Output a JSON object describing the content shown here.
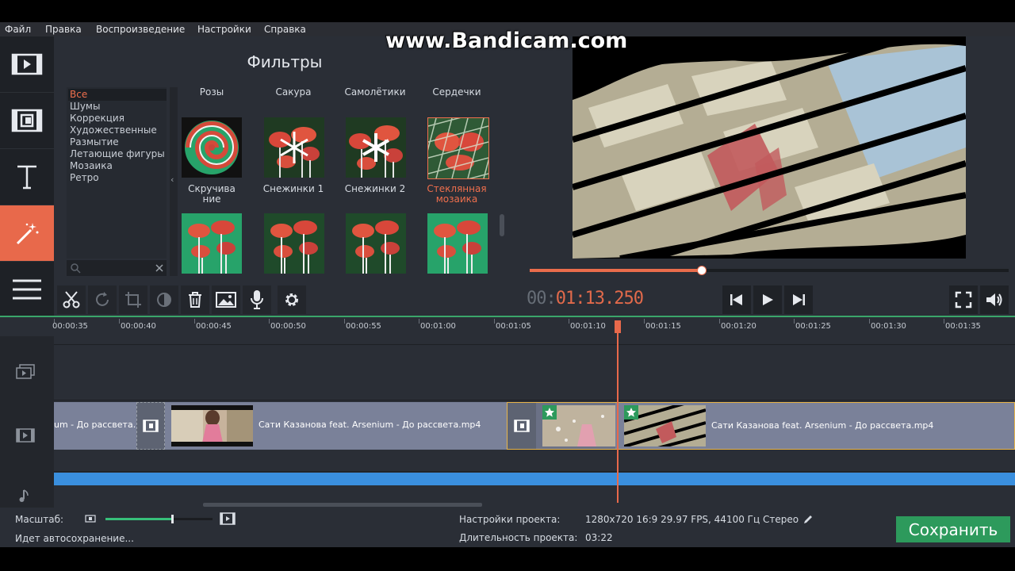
{
  "watermark": "www.Bandicam.com",
  "menu": [
    "Файл",
    "Правка",
    "Воспроизведение",
    "Настройки",
    "Справка"
  ],
  "left_tools": [
    {
      "icon": "film-import-icon",
      "active": false
    },
    {
      "icon": "transition-film-icon",
      "active": false
    },
    {
      "icon": "text-T-icon",
      "active": false
    },
    {
      "icon": "magic-wand-icon",
      "active": true
    },
    {
      "icon": "hamburger-menu-icon",
      "active": false
    }
  ],
  "filters": {
    "title": "Фильтры",
    "categories": [
      "Все",
      "Шумы",
      "Коррекция",
      "Художественные",
      "Размытие",
      "Летающие фигуры",
      "Мозаика",
      "Ретро"
    ],
    "selected_category": "Все",
    "collapse_glyph": "‹",
    "header_names": [
      "Розы",
      "Сакура",
      "Самолётики",
      "Сердечки"
    ],
    "row1_captions": [
      "Скручивание",
      "Снежинки 1",
      "Снежинки 2",
      "Стеклянная мозаика"
    ],
    "selected_filter": "Стеклянная мозаика",
    "accent": "#ef6f4d"
  },
  "player": {
    "timecode_prefix": "00:",
    "timecode_rest": "01:13.250",
    "progress": 0.36
  },
  "timeline": {
    "ruler": [
      "00:00:35",
      "00:00:40",
      "00:00:45",
      "00:00:50",
      "00:00:55",
      "00:01:00",
      "00:01:05",
      "00:01:10",
      "00:01:15",
      "00:01:20",
      "00:01:25",
      "00:01:30",
      "00:01:35"
    ],
    "clip1_label": "um - До рассвета.r",
    "clip2_label": "Сати Казанова feat. Arsenium - До рассвета.mp4",
    "clip3_label": "Сати Казанова feat. Arsenium - До рассвета.mp4"
  },
  "bottom": {
    "zoom_label": "Масштаб:",
    "zoom_level": 0.62,
    "autosave": "Идет автосохранение...",
    "settings_label": "Настройки проекта:",
    "settings_value": "1280x720 16:9 29.97 FPS, 44100 Гц Стерео",
    "duration_label": "Длительность проекта:",
    "duration_value": "03:22",
    "save_button": "Сохранить"
  },
  "colors": {
    "accent_orange": "#e8694b",
    "save_green": "#2d9a5c",
    "audio_blue": "#3a8fde",
    "panel_bg": "#2a2e36"
  }
}
